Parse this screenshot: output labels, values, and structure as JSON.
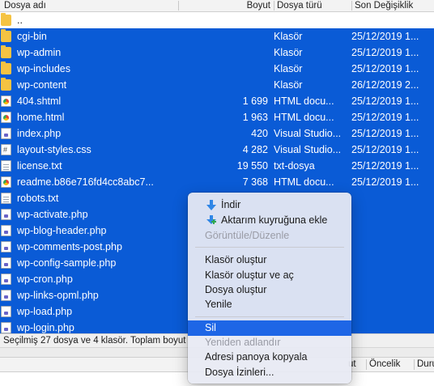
{
  "columns": {
    "name": "Dosya adı",
    "size": "Boyut",
    "type": "Dosya türü",
    "date": "Son Değişiklik"
  },
  "parent_row": "..",
  "files": [
    {
      "name": "cgi-bin",
      "size": "",
      "type": "Klasör",
      "date": "25/12/2019 1...",
      "icon": "folder-icon"
    },
    {
      "name": "wp-admin",
      "size": "",
      "type": "Klasör",
      "date": "25/12/2019 1...",
      "icon": "folder-icon"
    },
    {
      "name": "wp-includes",
      "size": "",
      "type": "Klasör",
      "date": "25/12/2019 1...",
      "icon": "folder-icon"
    },
    {
      "name": "wp-content",
      "size": "",
      "type": "Klasör",
      "date": "26/12/2019 2...",
      "icon": "folder-icon"
    },
    {
      "name": "404.shtml",
      "size": "1 699",
      "type": "HTML docu...",
      "date": "25/12/2019 1...",
      "icon": "chrome-file-icon"
    },
    {
      "name": "home.html",
      "size": "1 963",
      "type": "HTML docu...",
      "date": "25/12/2019 1...",
      "icon": "chrome-file-icon"
    },
    {
      "name": "index.php",
      "size": "420",
      "type": "Visual Studio...",
      "date": "25/12/2019 1...",
      "icon": "php-file-icon"
    },
    {
      "name": "layout-styles.css",
      "size": "4 282",
      "type": "Visual Studio...",
      "date": "25/12/2019 1...",
      "icon": "css-file-icon"
    },
    {
      "name": "license.txt",
      "size": "19 550",
      "type": "txt-dosya",
      "date": "25/12/2019 1...",
      "icon": "text-file-icon"
    },
    {
      "name": "readme.b86e716fd4cc8abc7...",
      "size": "7 368",
      "type": "HTML docu...",
      "date": "25/12/2019 1...",
      "icon": "chrome-file-icon"
    },
    {
      "name": "robots.txt",
      "size": "",
      "type": "",
      "date": "",
      "icon": "text-file-icon"
    },
    {
      "name": "wp-activate.php",
      "size": "",
      "type": "",
      "date": "",
      "icon": "php-file-icon"
    },
    {
      "name": "wp-blog-header.php",
      "size": "",
      "type": "",
      "date": "",
      "icon": "php-file-icon"
    },
    {
      "name": "wp-comments-post.php",
      "size": "",
      "type": "",
      "date": "",
      "icon": "php-file-icon"
    },
    {
      "name": "wp-config-sample.php",
      "size": "",
      "type": "",
      "date": "",
      "icon": "php-file-icon"
    },
    {
      "name": "wp-cron.php",
      "size": "",
      "type": "",
      "date": "",
      "icon": "php-file-icon"
    },
    {
      "name": "wp-links-opml.php",
      "size": "",
      "type": "",
      "date": "",
      "icon": "php-file-icon"
    },
    {
      "name": "wp-load.php",
      "size": "",
      "type": "",
      "date": "",
      "icon": "php-file-icon"
    },
    {
      "name": "wp-login.php",
      "size": "",
      "type": "",
      "date": "",
      "icon": "php-file-icon"
    }
  ],
  "status_text": "Seçilmiş 27 dosya ve 4 klasör. Toplam boyut",
  "queue_columns": {
    "c1": "ut",
    "c2": "Öncelik",
    "c3": "Duru"
  },
  "context_menu": {
    "download": "İndir",
    "add_to_queue": "Aktarım kuyruğuna ekle",
    "view_edit": "Görüntüle/Düzenle",
    "create_folder": "Klasör oluştur",
    "create_folder_open": "Klasör oluştur ve aç",
    "create_file": "Dosya oluştur",
    "refresh": "Yenile",
    "delete": "Sil",
    "rename": "Yeniden adlandır",
    "copy_url": "Adresi panoya kopyala",
    "permissions": "Dosya İzinleri..."
  },
  "colors": {
    "selection": "#0a5bd6",
    "menu_highlight": "#1e66e6",
    "folder": "#f5c342"
  }
}
